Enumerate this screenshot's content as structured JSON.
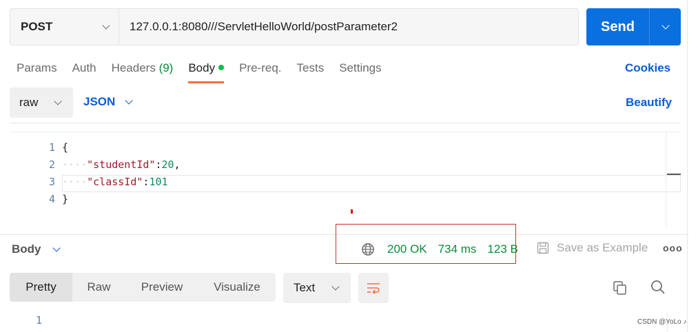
{
  "request": {
    "method": "POST",
    "url": "127.0.0.1:8080///ServletHelloWorld/postParameter2",
    "send_label": "Send"
  },
  "tabs": {
    "params": "Params",
    "auth": "Auth",
    "headers": "Headers",
    "headers_count": "(9)",
    "body": "Body",
    "prereq": "Pre-req.",
    "tests": "Tests",
    "settings": "Settings",
    "cookies": "Cookies"
  },
  "body_bar": {
    "mode": "raw",
    "format": "JSON",
    "beautify": "Beautify"
  },
  "editor": {
    "line_numbers": [
      "1",
      "2",
      "3",
      "4"
    ],
    "open_brace": "{",
    "key1": "\"studentId\"",
    "val1": "20",
    "key2": "\"classId\"",
    "val2": "101",
    "close_brace": "}"
  },
  "response": {
    "section_label": "Body",
    "status": "200 OK",
    "time": "734 ms",
    "size": "123 B",
    "save_example": "Save as Example",
    "more": "ooo",
    "view_tabs": [
      "Pretty",
      "Raw",
      "Preview",
      "Visualize"
    ],
    "text_format": "Text",
    "line_number": "1"
  },
  "watermark": "CSDN @YoLo ♪",
  "colors": {
    "accent": "#0a70e0",
    "link": "#0b5cd4",
    "status_ok": "#0a8a3a",
    "active_tab": "#ff6c37",
    "highlight_box": "#d62929"
  },
  "icons": {
    "globe": "globe-icon",
    "save": "save-icon",
    "wrap": "wrap-lines-icon",
    "copy": "copy-icon",
    "search": "search-icon"
  }
}
